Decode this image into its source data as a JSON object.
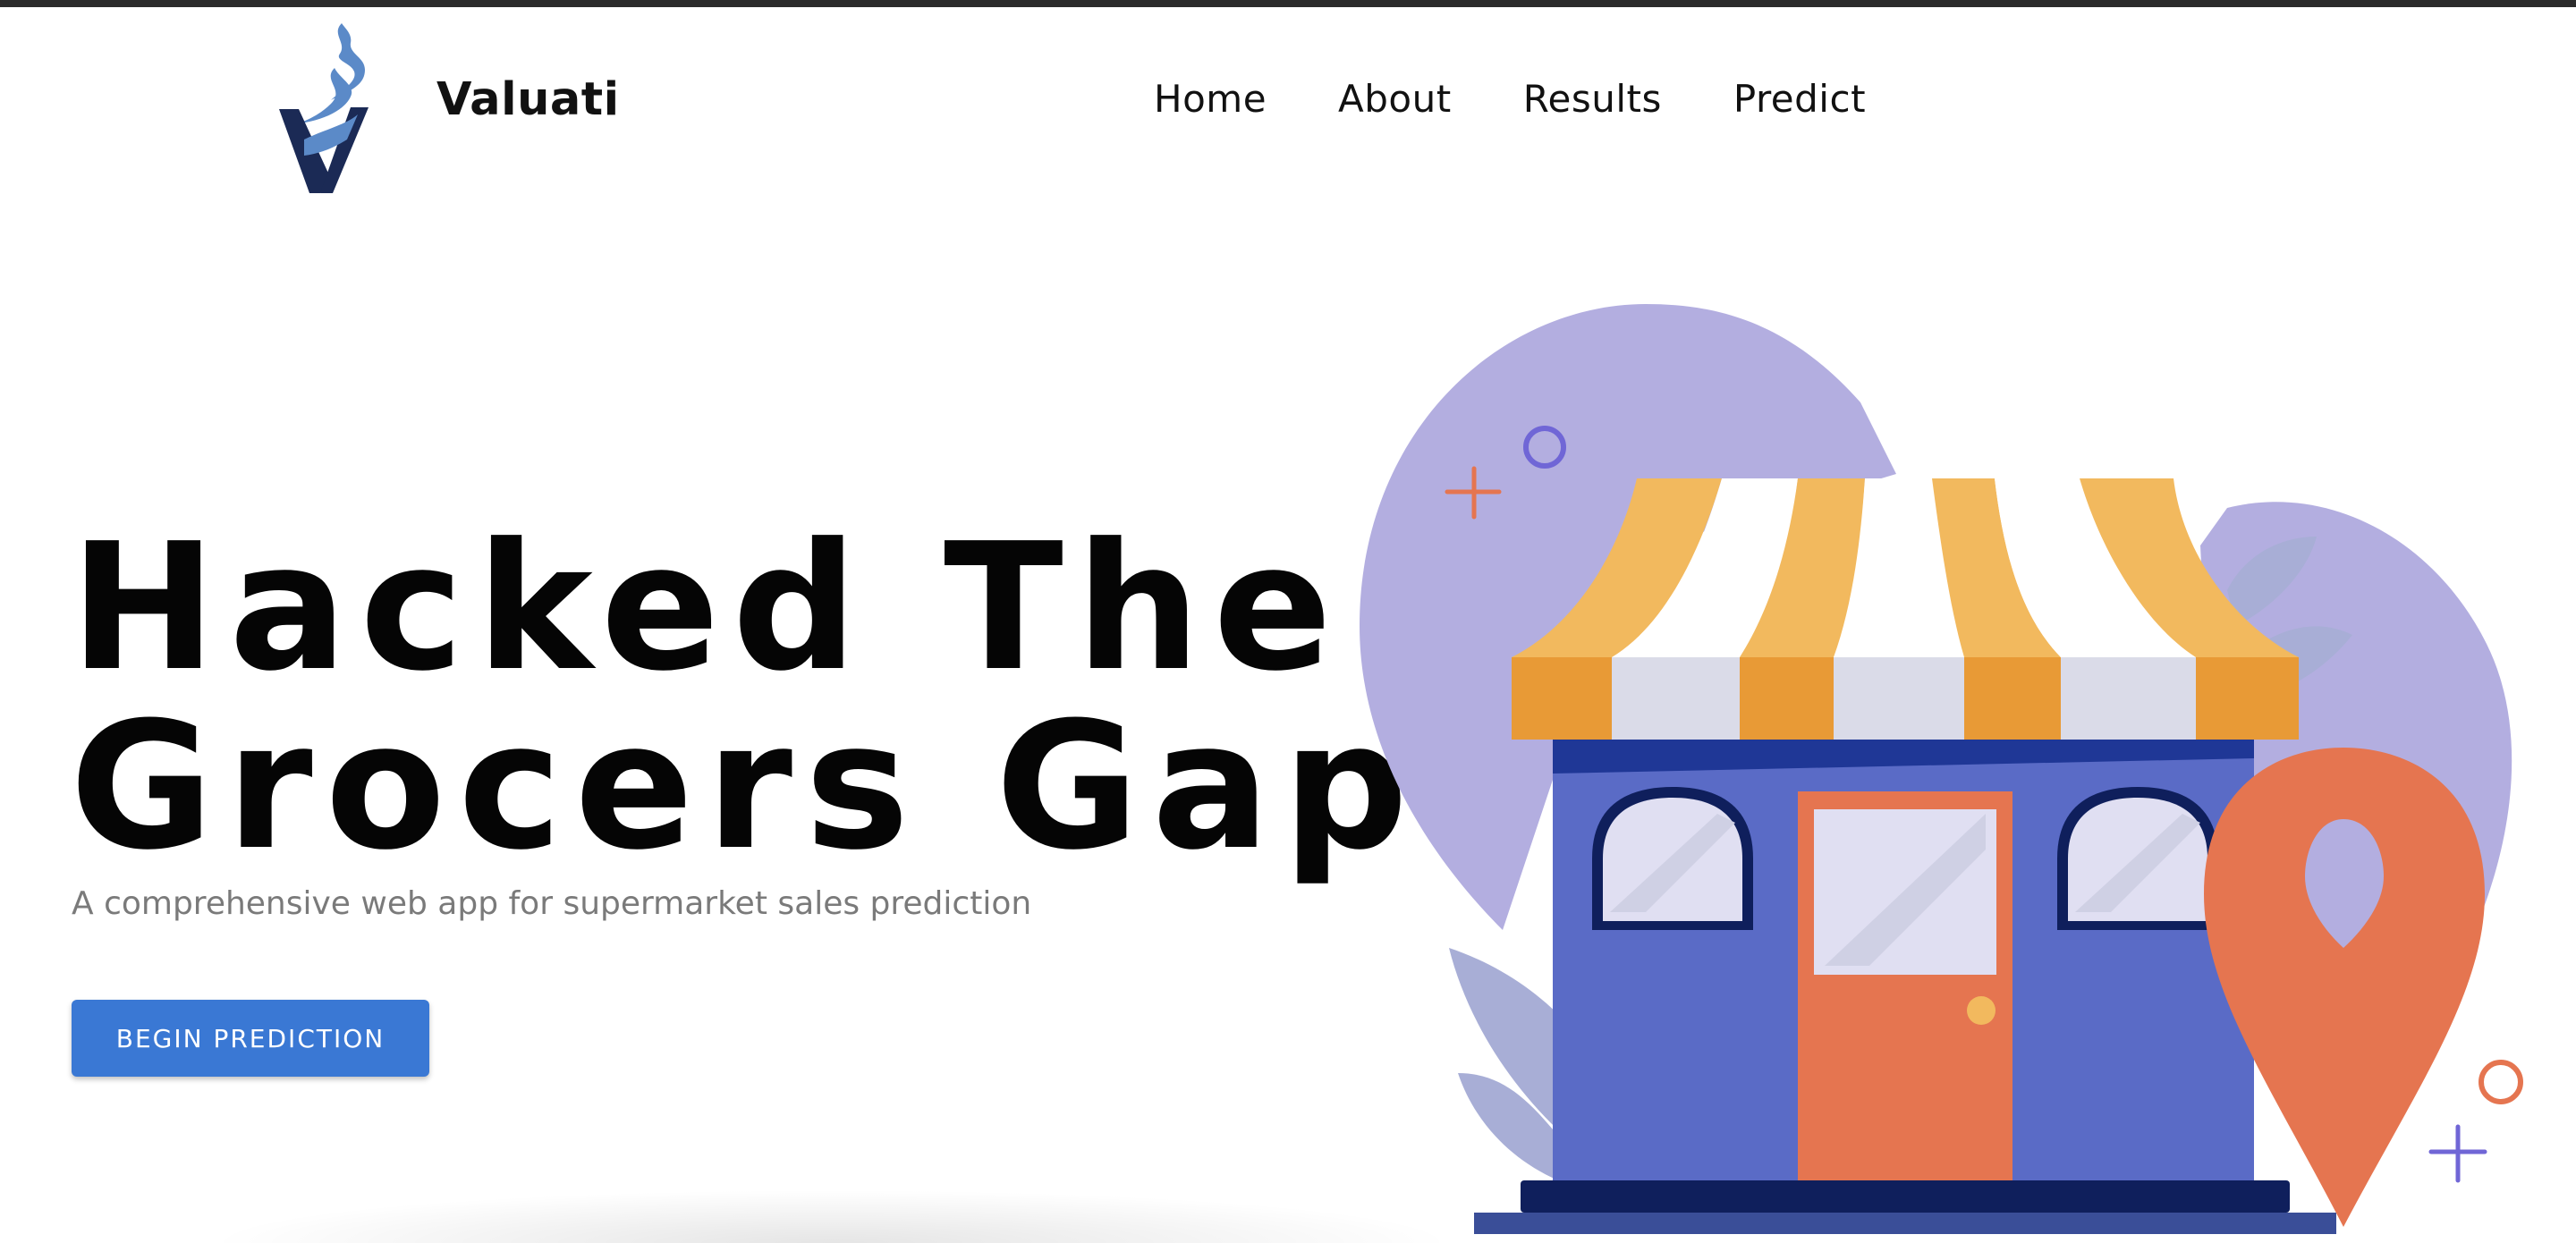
{
  "brand": {
    "name": "Valuati",
    "colors": {
      "light": "#5b8ac8",
      "dark": "#1b2a55"
    }
  },
  "nav": {
    "items": [
      {
        "label": "Home"
      },
      {
        "label": "About"
      },
      {
        "label": "Results"
      },
      {
        "label": "Predict"
      }
    ]
  },
  "hero": {
    "title_line_1": "Hacked The",
    "title_line_2": "Grocers Gap",
    "subtitle": "A comprehensive web app for supermarket sales prediction",
    "cta_label": "BEGIN PREDICTION"
  },
  "colors": {
    "accent": "#3a78d4",
    "blob": "#b3aee0",
    "awning_yellow": "#f2b95e",
    "awning_orange": "#e89a36",
    "store_blue": "#5a6bc6",
    "store_navy": "#0f1f5c",
    "door_orange": "#e57550",
    "pin_orange": "#e57550"
  },
  "icons": {
    "logo": "valuati-logo-icon",
    "illustration": "storefront-illustration",
    "pin": "location-pin-icon"
  }
}
